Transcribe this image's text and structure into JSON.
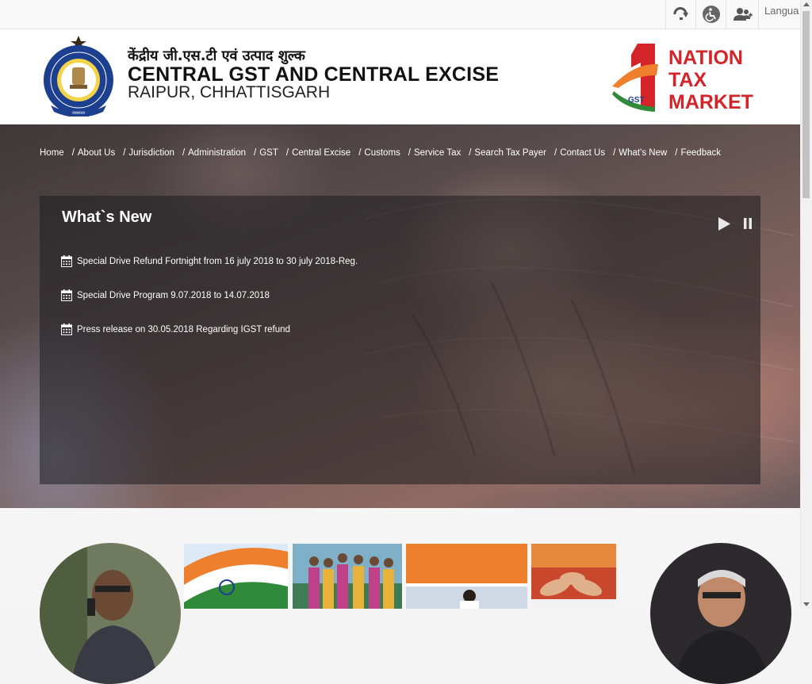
{
  "topbar": {
    "skip_icon": "skip-to-content-icon",
    "accessibility_icon": "accessibility-icon",
    "sitemap_icon": "users-icon",
    "language_label": "Langua"
  },
  "header": {
    "title_hindi": "केंद्रीय जी.एस.टी एवं उत्पाद शुल्क",
    "title_english": "CENTRAL GST AND CENTRAL EXCISE",
    "subtitle": "RAIPUR, CHHATTISGARH",
    "logo_right": {
      "big_digit": "1",
      "gst": "GST",
      "line1": "NATION",
      "line2": "TAX",
      "line3": "MARKET"
    }
  },
  "nav": {
    "items": [
      "Home",
      "About Us",
      "Jurisdiction",
      "Administration",
      "GST",
      "Central Excise",
      "Customs",
      "Service Tax",
      "Search Tax Payer",
      "Contact Us",
      "What's New",
      "Feedback"
    ],
    "separator": "/"
  },
  "whats_new": {
    "title": "What`s New",
    "items": [
      "Special Drive Refund Fortnight from 16 july 2018 to 30 july 2018-Reg.",
      "Special Drive Program 9.07.2018 to 14.07.2018",
      "Press release on 30.05.2018 Regarding IGST refund"
    ]
  },
  "colors": {
    "saffron": "#ee7f2d",
    "logo_red": "#d4242a",
    "navy": "#1c3f8f"
  }
}
